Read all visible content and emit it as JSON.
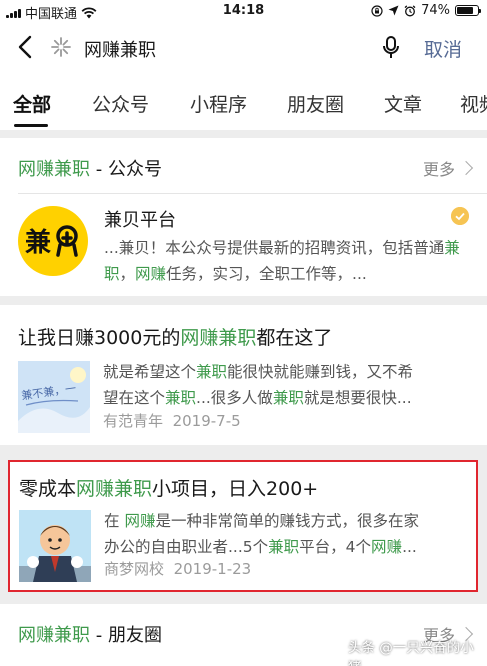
{
  "status_bar": {
    "carrier": "中国联通",
    "time": "14:18",
    "battery": "74%"
  },
  "search": {
    "query": "网赚兼职",
    "cancel_label": "取消"
  },
  "tabs": [
    {
      "label": "全部",
      "active": true
    },
    {
      "label": "公众号"
    },
    {
      "label": "小程序"
    },
    {
      "label": "朋友圈"
    },
    {
      "label": "文章"
    },
    {
      "label": "视频"
    }
  ],
  "official_accounts": {
    "title_keyword": "网赚兼职",
    "title_suffix": " - 公众号",
    "more_label": "更多",
    "account": {
      "logo_text": "兼贝",
      "name": "兼贝平台",
      "desc": [
        "...兼贝！本公众号提供最新的招聘资讯，包括普通",
        "兼职",
        "，",
        "网赚",
        "任务，实习，全职工作等，..."
      ]
    }
  },
  "articles": [
    {
      "title": [
        "让我日赚3000元的",
        "网赚兼职",
        "都在这了"
      ],
      "desc_line1": [
        "就是希望这个",
        "兼职",
        "能很快就能赚到钱，又不希"
      ],
      "desc_line2": [
        "望在这个",
        "兼职",
        "...很多人做",
        "兼职",
        "就是想要很快..."
      ],
      "source": "有范青年",
      "date": "2019-7-5",
      "thumb_text": "兼不兼，一"
    },
    {
      "title": [
        "零成本",
        "网赚兼职",
        "小项目，日入200+"
      ],
      "desc_line1": [
        "在 ",
        "网赚",
        "是一种非常简单的赚钱方式，很多在家"
      ],
      "desc_line2": [
        "办公的自由职业者...5个",
        "兼职",
        "平台，4个",
        "网赚",
        "..."
      ],
      "source": "商梦网校",
      "date": "2019-1-23",
      "highlighted": true
    }
  ],
  "moments": {
    "title_keyword": "网赚兼职",
    "title_suffix": " - 朋友圈",
    "more_label": "更多"
  },
  "watermark": "头条 @一只兴奋的小猪",
  "colors": {
    "highlight_green": "#3f9a4c",
    "link_blue": "#576b95",
    "logo_yellow": "#ffd100",
    "highlight_border": "#e0262f"
  }
}
